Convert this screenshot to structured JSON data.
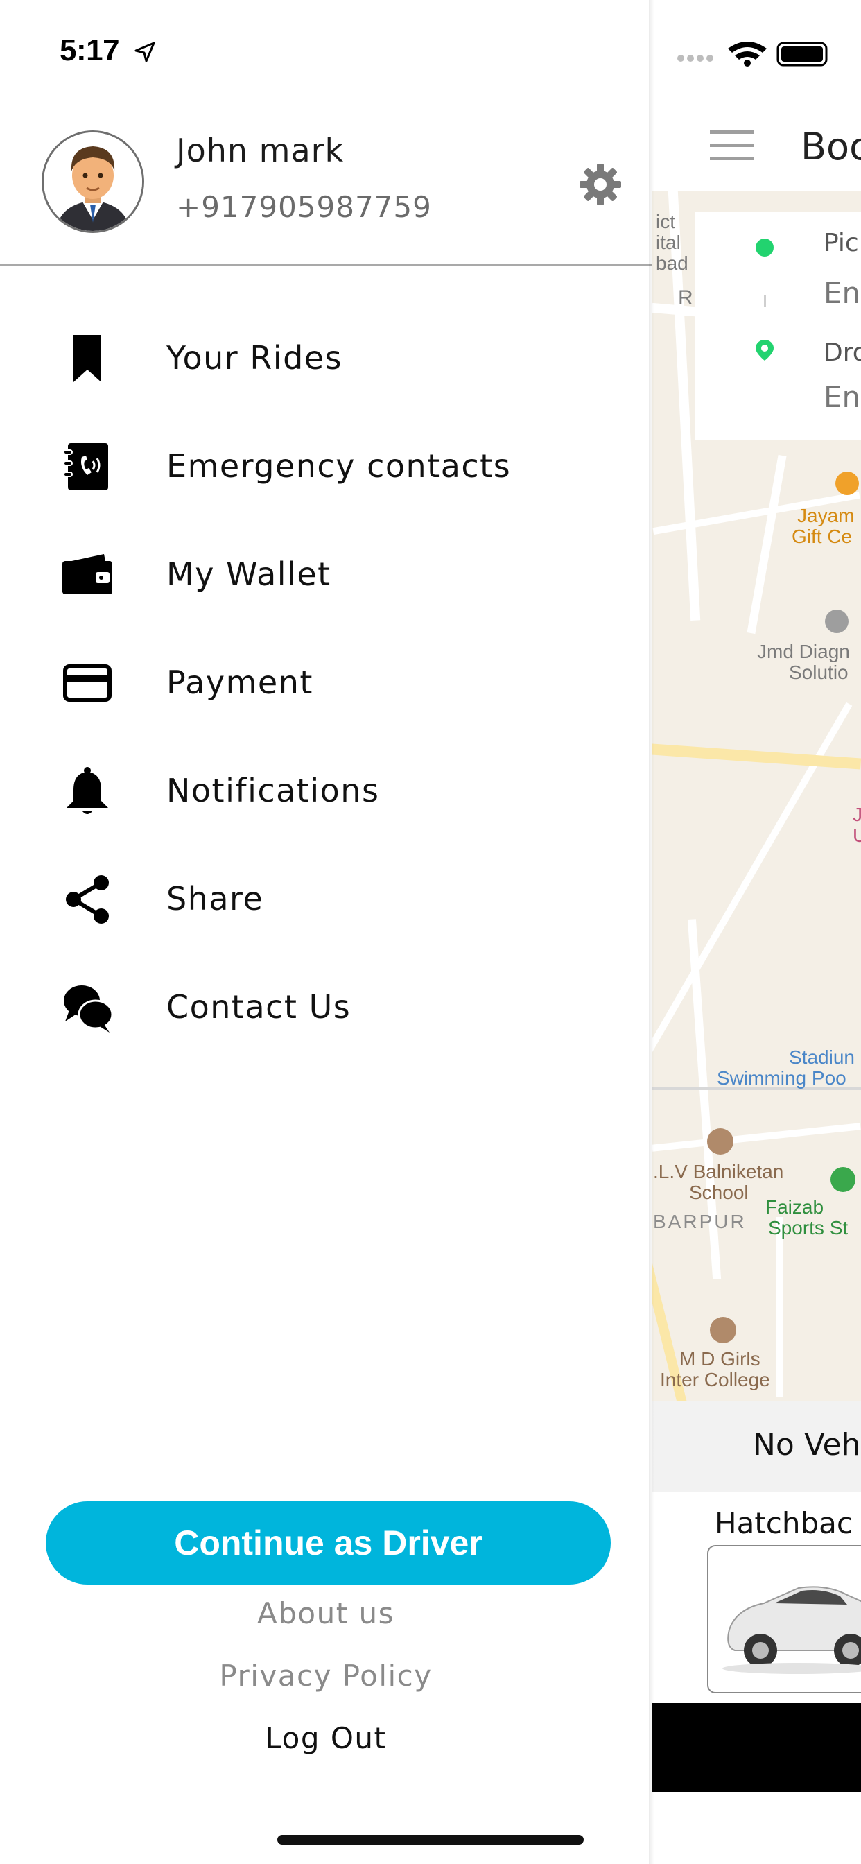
{
  "status_bar": {
    "time": "5:17"
  },
  "profile": {
    "name": "John mark",
    "phone": "+917905987759",
    "avatar_icon": "man-in-suit-avatar",
    "settings_icon": "gear-icon"
  },
  "menu": [
    {
      "label": "Your Rides",
      "icon": "bookmark-icon"
    },
    {
      "label": "Emergency contacts",
      "icon": "phone-book-icon"
    },
    {
      "label": "My Wallet",
      "icon": "wallet-icon"
    },
    {
      "label": "Payment",
      "icon": "credit-card-icon"
    },
    {
      "label": "Notifications",
      "icon": "bell-icon"
    },
    {
      "label": "Share",
      "icon": "share-icon"
    },
    {
      "label": "Contact Us",
      "icon": "chat-bubbles-icon"
    }
  ],
  "footer": {
    "driver_button": "Continue as Driver",
    "about": "About us",
    "privacy": "Privacy Policy",
    "logout": "Log Out"
  },
  "colors": {
    "accent": "#00b5dc",
    "pickup_green": "#22d36f",
    "footer_link": "#8a8a8a"
  },
  "background_screen": {
    "title": "Boo",
    "pickup_label": "Pic",
    "pickup_placeholder": "En",
    "drop_label": "Dro",
    "drop_placeholder": "En",
    "map_labels": {
      "district": "ict",
      "hospital": "ital",
      "bad": "bad",
      "r": "R",
      "jayam_1": "Jayam",
      "jayam_2": "Gift Ce",
      "jmd_1": "Jmd Diagn",
      "jmd_2": "Solutio",
      "j": "J",
      "u": "U",
      "stadium": "Stadiun",
      "pool": "Swimming Poo",
      "school_1": ".L.V Balniketan",
      "school_2": "School",
      "barpur": "BARPUR",
      "faizab_1": "Faizab",
      "faizab_2": "Sports St",
      "college_1": "M D Girls",
      "college_2": "Inter College"
    },
    "vehicle_status": "No Veh",
    "vehicle_type": "Hatchbac"
  }
}
